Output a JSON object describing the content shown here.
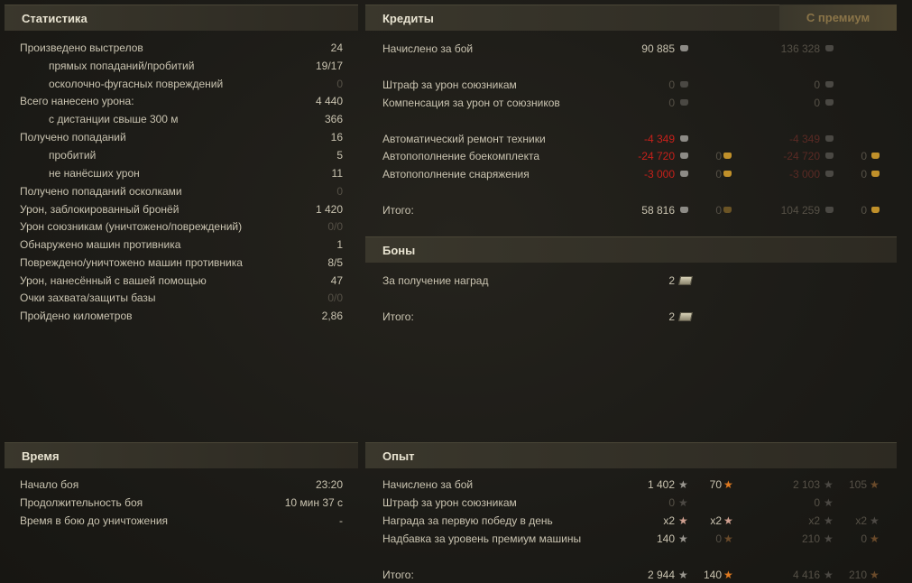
{
  "stats": {
    "title": "Статистика",
    "rows": [
      {
        "label": "Произведено выстрелов",
        "value": "24",
        "indent": false,
        "dim": false
      },
      {
        "label": "прямых попаданий/пробитий",
        "value": "19/17",
        "indent": true,
        "dim": false
      },
      {
        "label": "осколочно-фугасных повреждений",
        "value": "0",
        "indent": true,
        "dim": true
      },
      {
        "label": "Всего нанесено урона:",
        "value": "4 440",
        "indent": false,
        "dim": false
      },
      {
        "label": "с дистанции свыше 300 м",
        "value": "366",
        "indent": true,
        "dim": false
      },
      {
        "label": "Получено попаданий",
        "value": "16",
        "indent": false,
        "dim": false
      },
      {
        "label": "пробитий",
        "value": "5",
        "indent": true,
        "dim": false
      },
      {
        "label": "не нанёсших урон",
        "value": "11",
        "indent": true,
        "dim": false
      },
      {
        "label": "Получено попаданий осколками",
        "value": "0",
        "indent": false,
        "dim": true
      },
      {
        "label": "Урон, заблокированный бронёй",
        "value": "1 420",
        "indent": false,
        "dim": false
      },
      {
        "label": "Урон союзникам (уничтожено/повреждений)",
        "value": "0/0",
        "indent": false,
        "dim": true
      },
      {
        "label": "Обнаружено машин противника",
        "value": "1",
        "indent": false,
        "dim": false
      },
      {
        "label": "Повреждено/уничтожено машин противника",
        "value": "8/5",
        "indent": false,
        "dim": false
      },
      {
        "label": "Урон, нанесённый с вашей помощью",
        "value": "47",
        "indent": false,
        "dim": false
      },
      {
        "label": "Очки захвата/защиты базы",
        "value": "0/0",
        "indent": false,
        "dim": true
      },
      {
        "label": "Пройдено километров",
        "value": "2,86",
        "indent": false,
        "dim": false
      }
    ]
  },
  "time": {
    "title": "Время",
    "rows": [
      {
        "label": "Начало боя",
        "value": "23:20"
      },
      {
        "label": "Продолжительность боя",
        "value": "10 мин 37 с"
      },
      {
        "label": "Время в бою до уничтожения",
        "value": "-"
      }
    ]
  },
  "credits": {
    "title": "Кредиты",
    "premium_label": "С премиум",
    "earned": {
      "label": "Начислено за бой",
      "base": "90 885",
      "prem": "136 328"
    },
    "ally_fine": {
      "label": "Штраф за урон союзникам",
      "base": "0",
      "prem": "0"
    },
    "ally_comp": {
      "label": "Компенсация за урон от союзников",
      "base": "0",
      "prem": "0"
    },
    "repair": {
      "label": "Автоматический ремонт техники",
      "base": "-4 349",
      "prem": "-4 349"
    },
    "ammo": {
      "label": "Автопополнение боекомплекта",
      "base": "-24 720",
      "base_gold": "0",
      "prem": "-24 720",
      "prem_gold": "0"
    },
    "equip": {
      "label": "Автопополнение снаряжения",
      "base": "-3 000",
      "base_gold": "0",
      "prem": "-3 000",
      "prem_gold": "0"
    },
    "total": {
      "label": "Итого:",
      "base": "58 816",
      "base_gold": "0",
      "prem": "104 259",
      "prem_gold": "0"
    }
  },
  "bonds": {
    "title": "Боны",
    "awards": {
      "label": "За получение наград",
      "value": "2"
    },
    "total": {
      "label": "Итого:",
      "value": "2"
    }
  },
  "xp": {
    "title": "Опыт",
    "earned": {
      "label": "Начислено за бой",
      "base": "1 402",
      "free": "70",
      "prem": "2 103",
      "prem_free": "105"
    },
    "ally_fine": {
      "label": "Штраф за урон союзникам",
      "base": "0",
      "prem": "0"
    },
    "first_win": {
      "label": "Награда за первую победу в день",
      "base": "x2",
      "free": "x2",
      "prem": "x2",
      "prem_free": "x2"
    },
    "premium_vehicle": {
      "label": "Надбавка за уровень премиум машины",
      "base": "140",
      "free": "0",
      "prem": "210",
      "prem_free": "0"
    },
    "total": {
      "label": "Итого:",
      "base": "2 944",
      "free": "140",
      "prem": "4 416",
      "prem_free": "210"
    }
  },
  "icons": {
    "credit": "credit-coin-icon",
    "gold": "gold-coin-icon",
    "xp": "xp-star-icon",
    "free_xp": "free-xp-star-icon",
    "bond": "bond-icon"
  }
}
